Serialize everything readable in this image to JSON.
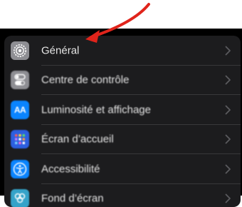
{
  "settings": {
    "items": [
      {
        "label": "Général",
        "icon": "gear-icon",
        "color": "#8e8e93"
      },
      {
        "label": "Centre de contrôle",
        "icon": "toggles-icon",
        "color": "#8e8e93"
      },
      {
        "label": "Luminosité et affichage",
        "icon": "text-size-icon",
        "icon_text": "AA",
        "color": "#0a84ff"
      },
      {
        "label": "Écran d’accueil",
        "icon": "home-grid-icon",
        "color": "#2c5fe0"
      },
      {
        "label": "Accessibilité",
        "icon": "accessibility-icon",
        "color": "#0a84ff"
      },
      {
        "label": "Fond d’écran",
        "icon": "wallpaper-icon",
        "color": "#35a3c9"
      }
    ]
  },
  "annotation": {
    "arrow_color": "#e0241b",
    "points_to": "Général"
  },
  "theme": {
    "background": "#000000",
    "group_background": "#1c1c1e",
    "separator": "#38383a",
    "chevron": "#5a5a5e"
  }
}
